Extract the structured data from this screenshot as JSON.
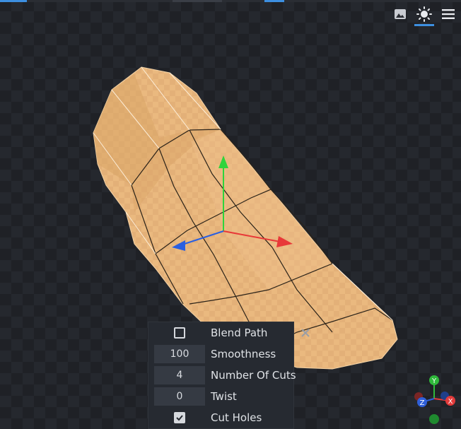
{
  "toolbar": {
    "icons": [
      "image-icon",
      "sun-icon",
      "menu-icon"
    ],
    "active_icon": "sun-icon",
    "accent_color": "#3d8fe0"
  },
  "panel": {
    "blend_path": {
      "label": "Blend Path",
      "checked": false
    },
    "smoothness": {
      "label": "Smoothness",
      "value": "100"
    },
    "number_of_cuts": {
      "label": "Number Of Cuts",
      "value": "4"
    },
    "twist": {
      "label": "Twist",
      "value": "0"
    },
    "cut_holes": {
      "label": "Cut Holes",
      "checked": true
    }
  },
  "gizmo": {
    "x_label": "X",
    "y_label": "Y",
    "z_label": "Z",
    "x_color": "#e23b3b",
    "y_color": "#2fb83b",
    "z_color": "#2f5fd8"
  }
}
